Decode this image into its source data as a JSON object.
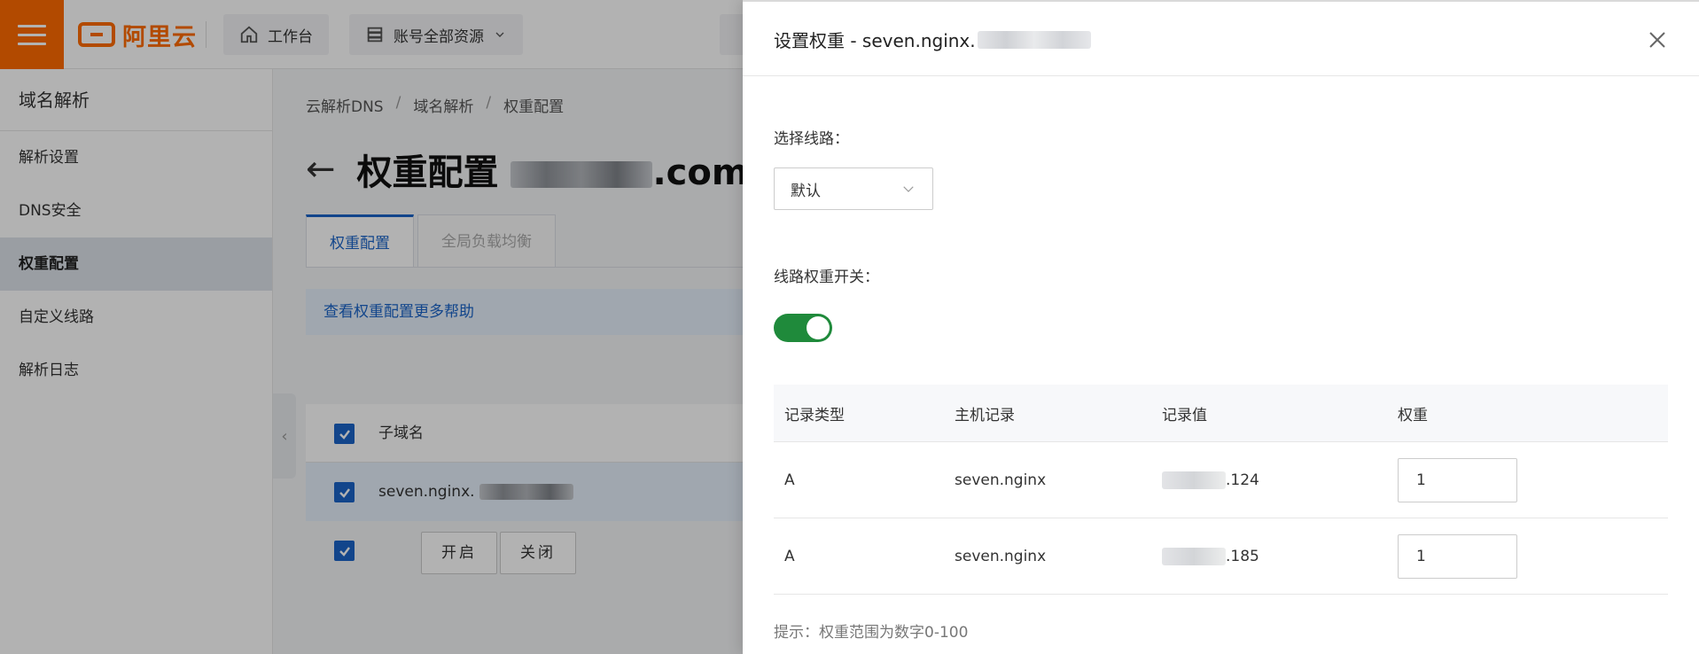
{
  "header": {
    "logo_text": "阿里云",
    "workbench_label": "工作台",
    "resources_label": "账号全部资源"
  },
  "sidebar": {
    "title": "域名解析",
    "items": [
      {
        "label": "解析设置",
        "active": false
      },
      {
        "label": "DNS安全",
        "active": false
      },
      {
        "label": "权重配置",
        "active": true
      },
      {
        "label": "自定义线路",
        "active": false
      },
      {
        "label": "解析日志",
        "active": false
      }
    ]
  },
  "breadcrumb": [
    "云解析DNS",
    "域名解析",
    "权重配置"
  ],
  "page": {
    "title": "权重配置",
    "title_suffix": ".com",
    "tabs": [
      {
        "label": "权重配置",
        "active": true
      },
      {
        "label": "全局负载均衡",
        "active": false
      }
    ],
    "help_text": "查看权重配置更多帮助",
    "table": {
      "header": "子域名",
      "rows": [
        {
          "subdomain": "seven.nginx."
        }
      ]
    },
    "actions": {
      "enable_label": "开启",
      "disable_label": "关闭"
    }
  },
  "drawer": {
    "title": "设置权重 - seven.nginx.",
    "line_label": "选择线路：",
    "line_value": "默认",
    "switch_label": "线路权重开关：",
    "switch_on": true,
    "table": {
      "headers": [
        "记录类型",
        "主机记录",
        "记录值",
        "权重"
      ],
      "rows": [
        {
          "type": "A",
          "host": "seven.nginx",
          "value_suffix": ".124",
          "weight": "1"
        },
        {
          "type": "A",
          "host": "seven.nginx",
          "value_suffix": ".185",
          "weight": "1"
        }
      ]
    },
    "hint": "提示：权重范围为数字0-100"
  },
  "colors": {
    "brand": "#ff6a00",
    "primary": "#1a64c8",
    "switch_on": "#1f8a3b"
  }
}
